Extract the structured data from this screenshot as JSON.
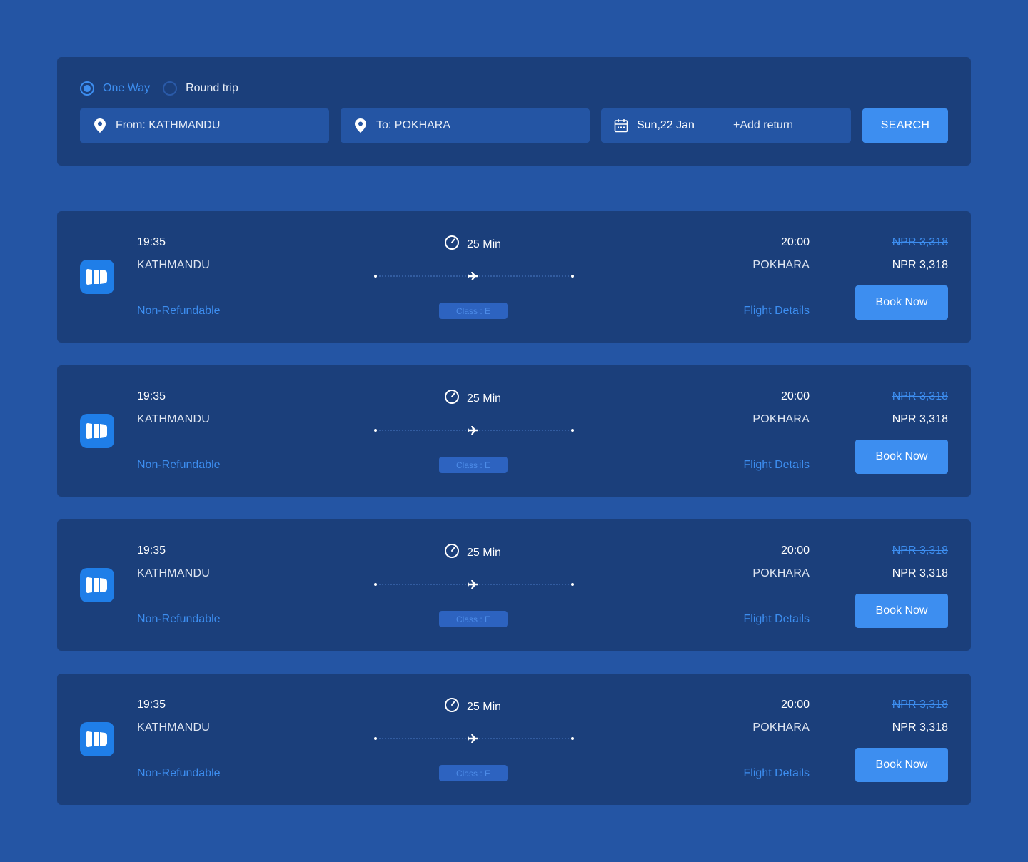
{
  "search": {
    "trip_types": [
      {
        "label": "One Way",
        "selected": true
      },
      {
        "label": "Round trip",
        "selected": false
      }
    ],
    "from": "From: KATHMANDU",
    "to": "To: POKHARA",
    "date": "Sun,22 Jan",
    "add_return": "+Add return",
    "search_label": "SEARCH"
  },
  "colors": {
    "background": "#2455a4",
    "panel": "#1b3f7b",
    "accent": "#3d8ef0"
  },
  "flights": [
    {
      "dep_time": "19:35",
      "dep_city": "KATHMANDU",
      "refund": "Non-Refundable",
      "duration": "25 Min",
      "class": "Class : E",
      "arr_time": "20:00",
      "arr_city": "POKHARA",
      "details": "Flight Details",
      "old_price": "NPR 3,318",
      "price": "NPR 3,318",
      "book": "Book Now"
    },
    {
      "dep_time": "19:35",
      "dep_city": "KATHMANDU",
      "refund": "Non-Refundable",
      "duration": "25 Min",
      "class": "Class : E",
      "arr_time": "20:00",
      "arr_city": "POKHARA",
      "details": "Flight Details",
      "old_price": "NPR 3,318",
      "price": "NPR 3,318",
      "book": "Book Now"
    },
    {
      "dep_time": "19:35",
      "dep_city": "KATHMANDU",
      "refund": "Non-Refundable",
      "duration": "25 Min",
      "class": "Class : E",
      "arr_time": "20:00",
      "arr_city": "POKHARA",
      "details": "Flight Details",
      "old_price": "NPR 3,318",
      "price": "NPR 3,318",
      "book": "Book Now"
    },
    {
      "dep_time": "19:35",
      "dep_city": "KATHMANDU",
      "refund": "Non-Refundable",
      "duration": "25 Min",
      "class": "Class : E",
      "arr_time": "20:00",
      "arr_city": "POKHARA",
      "details": "Flight Details",
      "old_price": "NPR 3,318",
      "price": "NPR 3,318",
      "book": "Book Now"
    }
  ]
}
